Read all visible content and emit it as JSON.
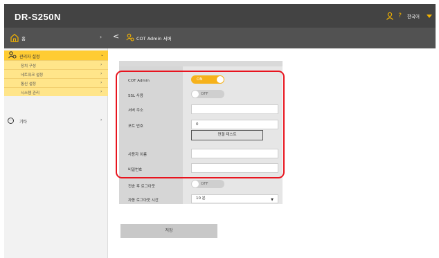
{
  "app": {
    "title": "DR-S250N",
    "language": "한국어",
    "help": "?"
  },
  "nav": {
    "home": "홈",
    "breadcrumb": "COT Admin 서버"
  },
  "sidebar": {
    "section": "관리자 설정",
    "items": [
      {
        "label": "장치 구성"
      },
      {
        "label": "네트워크 설정"
      },
      {
        "label": "통신 설정"
      },
      {
        "label": "시스템 관리"
      }
    ],
    "other": "기타"
  },
  "form": {
    "cot_admin": {
      "label": "COT Admin",
      "state": "ON"
    },
    "ssl": {
      "label": "SSL 사용",
      "state": "OFF"
    },
    "server_address": {
      "label": "서버 주소",
      "value": ""
    },
    "port": {
      "label": "포트 번호",
      "value": "0"
    },
    "test_button": "연결 테스트",
    "username": {
      "label": "사용자 이름",
      "value": ""
    },
    "password": {
      "label": "비밀번호",
      "value": ""
    },
    "logout_after_send": {
      "label": "전송 후 로그아웃",
      "state": "OFF"
    },
    "auto_logout": {
      "label": "자동 로그아웃 시간",
      "value": "10 분"
    },
    "save_button": "저장"
  },
  "colors": {
    "accent": "#f6b21b",
    "sidebar_active": "#ffcc33",
    "highlight": "#e8141e"
  }
}
